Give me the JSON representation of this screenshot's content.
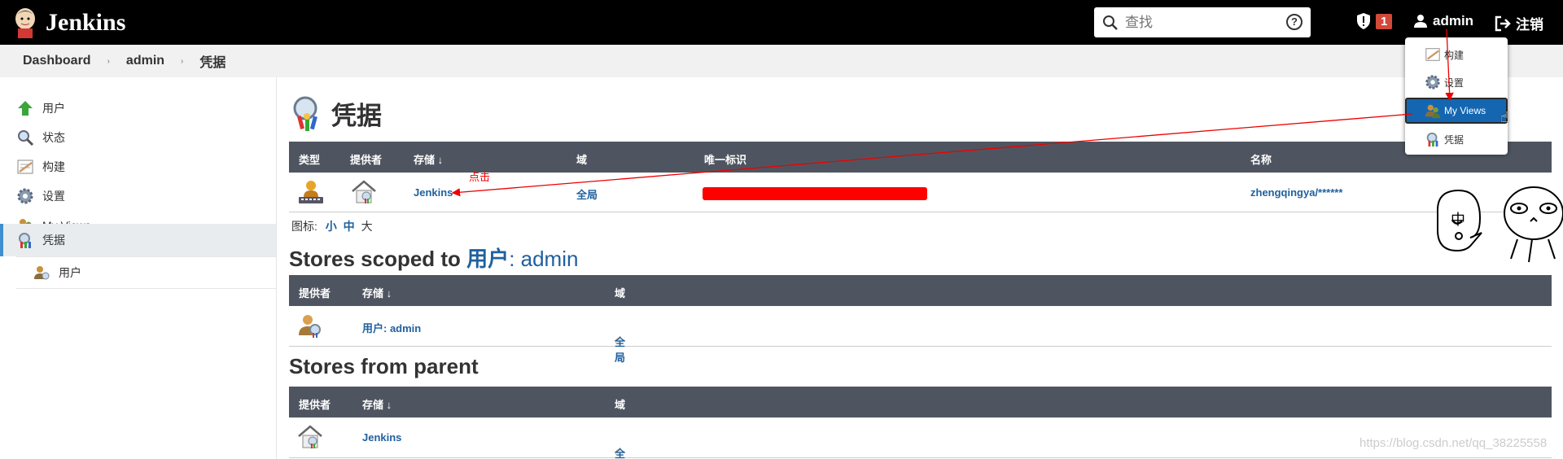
{
  "header": {
    "title": "Jenkins",
    "search_placeholder": "查找",
    "help": "?",
    "alerts": "1",
    "user": "admin",
    "logout": "注销"
  },
  "breadcrumb": [
    "Dashboard",
    "admin",
    "凭据"
  ],
  "sidebar": {
    "items": [
      {
        "label": "用户",
        "icon": "up-arrow-icon"
      },
      {
        "label": "状态",
        "icon": "magnifier-icon"
      },
      {
        "label": "构建",
        "icon": "notepad-icon"
      },
      {
        "label": "设置",
        "icon": "gear-icon"
      },
      {
        "label": "My Views",
        "icon": "user-group-icon"
      },
      {
        "label": "凭据",
        "icon": "credentials-icon"
      }
    ],
    "sub": {
      "label": "用户",
      "icon": "user-icon"
    }
  },
  "main": {
    "title": "凭据",
    "table1": {
      "headers": [
        "类型",
        "提供者",
        "存储 ↓",
        "域",
        "唯一标识",
        "名称"
      ],
      "row": {
        "store": "Jenkins",
        "domain": "全局",
        "name": "zhengqingya/******"
      }
    },
    "icon_size": {
      "label": "图标:",
      "small": "小",
      "medium": "中",
      "large": "大"
    },
    "h2_scoped": {
      "prefix": "Stores scoped to",
      "link": "用户",
      "suffix": ": admin"
    },
    "table2": {
      "headers": [
        "提供者",
        "存储 ↓",
        "域"
      ],
      "row": {
        "store": "用户: admin",
        "domain": "全局"
      }
    },
    "h2_parent": "Stores from parent",
    "table3": {
      "headers": [
        "提供者",
        "存储 ↓",
        "域"
      ],
      "row": {
        "store": "Jenkins",
        "domain": "全局"
      }
    }
  },
  "dropdown": {
    "items": [
      "构建",
      "设置",
      "My Views",
      "凭据"
    ]
  },
  "annotation": {
    "click": "点击",
    "sticker": "中"
  },
  "watermark": "https://blog.csdn.net/qq_38225558",
  "colors": {
    "header": "#000000",
    "link": "#20609f",
    "table_head": "#4f5560",
    "highlight": "#1566b1",
    "annotation": "#e00000",
    "redact": "#ff0000"
  }
}
